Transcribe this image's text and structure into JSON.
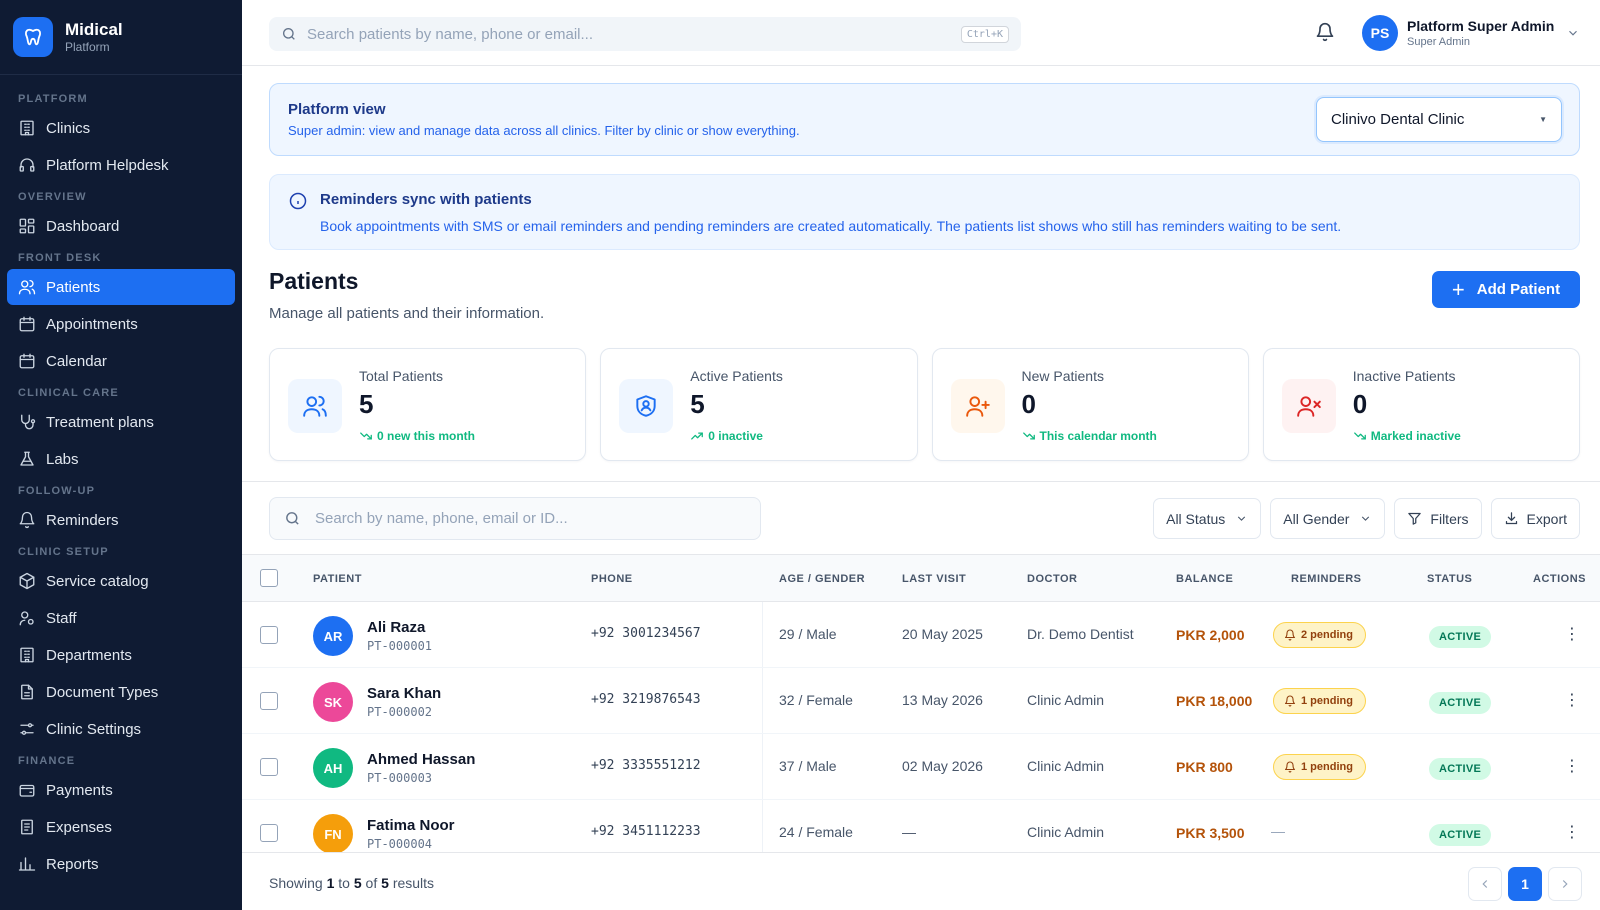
{
  "brand": {
    "name": "Midical",
    "sub": "Platform"
  },
  "sidebar": {
    "sections": [
      {
        "label": "PLATFORM",
        "items": [
          {
            "label": "Clinics",
            "icon": "building-icon"
          },
          {
            "label": "Platform Helpdesk",
            "icon": "headset-icon"
          }
        ]
      },
      {
        "label": "OVERVIEW",
        "items": [
          {
            "label": "Dashboard",
            "icon": "grid-icon"
          }
        ]
      },
      {
        "label": "FRONT DESK",
        "items": [
          {
            "label": "Patients",
            "icon": "users-icon",
            "active": true
          },
          {
            "label": "Appointments",
            "icon": "calendar-icon"
          },
          {
            "label": "Calendar",
            "icon": "calendar-icon"
          }
        ]
      },
      {
        "label": "CLINICAL CARE",
        "items": [
          {
            "label": "Treatment plans",
            "icon": "stethoscope-icon"
          },
          {
            "label": "Labs",
            "icon": "flask-icon"
          }
        ]
      },
      {
        "label": "FOLLOW-UP",
        "items": [
          {
            "label": "Reminders",
            "icon": "bell-icon"
          }
        ]
      },
      {
        "label": "CLINIC SETUP",
        "items": [
          {
            "label": "Service catalog",
            "icon": "package-icon"
          },
          {
            "label": "Staff",
            "icon": "user-cog-icon"
          },
          {
            "label": "Departments",
            "icon": "building-icon"
          },
          {
            "label": "Document Types",
            "icon": "document-icon"
          },
          {
            "label": "Clinic Settings",
            "icon": "sliders-icon"
          }
        ]
      },
      {
        "label": "FINANCE",
        "items": [
          {
            "label": "Payments",
            "icon": "wallet-icon"
          },
          {
            "label": "Expenses",
            "icon": "receipt-icon"
          },
          {
            "label": "Reports",
            "icon": "chart-icon"
          }
        ]
      }
    ]
  },
  "topbar": {
    "search_placeholder": "Search patients by name, phone or email...",
    "shortcut": "Ctrl+K",
    "user": {
      "initials": "PS",
      "name": "Platform Super Admin",
      "role": "Super Admin"
    }
  },
  "platform_view": {
    "title": "Platform view",
    "description": "Super admin: view and manage data across all clinics. Filter by clinic or show everything.",
    "selected_clinic": "Clinivo Dental Clinic"
  },
  "reminder_banner": {
    "title": "Reminders sync with patients",
    "description": "Book appointments with SMS or email reminders and pending reminders are created automatically. The patients list shows who still has reminders waiting to be sent."
  },
  "page": {
    "title": "Patients",
    "subtitle": "Manage all patients and their information.",
    "add_label": "Add Patient"
  },
  "stats": [
    {
      "label": "Total Patients",
      "value": "5",
      "trend": "0 new this month",
      "icon": "users-icon",
      "bg": "#eff6ff",
      "color": "#1d6ff2",
      "trend_dir": "down"
    },
    {
      "label": "Active Patients",
      "value": "5",
      "trend": "0 inactive",
      "icon": "shield-user-icon",
      "bg": "#eff6ff",
      "color": "#1d6ff2",
      "trend_dir": "up"
    },
    {
      "label": "New Patients",
      "value": "0",
      "trend": "This calendar month",
      "icon": "user-plus-icon",
      "bg": "#fff7ed",
      "color": "#ea580c",
      "trend_dir": "down"
    },
    {
      "label": "Inactive Patients",
      "value": "0",
      "trend": "Marked inactive",
      "icon": "user-x-icon",
      "bg": "#fef2f2",
      "color": "#dc2626",
      "trend_dir": "down"
    }
  ],
  "table_toolbar": {
    "search_placeholder": "Search by name, phone, email or ID...",
    "status_filter": "All Status",
    "gender_filter": "All Gender",
    "filters_label": "Filters",
    "export_label": "Export"
  },
  "table": {
    "headers": {
      "patient": "PATIENT",
      "phone": "PHONE",
      "age_gender": "AGE / GENDER",
      "last_visit": "LAST VISIT",
      "doctor": "DOCTOR",
      "balance": "BALANCE",
      "reminders": "REMINDERS",
      "status": "STATUS",
      "actions": "ACTIONS"
    },
    "rows": [
      {
        "initials": "AR",
        "color": "#1d6ff2",
        "name": "Ali Raza",
        "id": "PT-000001",
        "phone": "+92 3001234567",
        "age_gender": "29 / Male",
        "last_visit": "20 May 2025",
        "doctor": "Dr. Demo Dentist",
        "balance": "PKR 2,000",
        "reminders": "2 pending",
        "status": "ACTIVE"
      },
      {
        "initials": "SK",
        "color": "#ec4899",
        "name": "Sara Khan",
        "id": "PT-000002",
        "phone": "+92 3219876543",
        "age_gender": "32 / Female",
        "last_visit": "13 May 2026",
        "doctor": "Clinic Admin",
        "balance": "PKR 18,000",
        "reminders": "1 pending",
        "status": "ACTIVE"
      },
      {
        "initials": "AH",
        "color": "#10b981",
        "name": "Ahmed Hassan",
        "id": "PT-000003",
        "phone": "+92 3335551212",
        "age_gender": "37 / Male",
        "last_visit": "02 May 2026",
        "doctor": "Clinic Admin",
        "balance": "PKR 800",
        "reminders": "1 pending",
        "status": "ACTIVE"
      },
      {
        "initials": "FN",
        "color": "#f59e0b",
        "name": "Fatima Noor",
        "id": "PT-000004",
        "phone": "+92 3451112233",
        "age_gender": "24 / Female",
        "last_visit": "—",
        "doctor": "Clinic Admin",
        "balance": "PKR 3,500",
        "reminders": "—",
        "status": "ACTIVE"
      }
    ]
  },
  "footer": {
    "prefix": "Showing",
    "from": "1",
    "to_word": "to",
    "to": "5",
    "of_word": "of",
    "total": "5",
    "suffix": "results",
    "current_page": "1"
  }
}
